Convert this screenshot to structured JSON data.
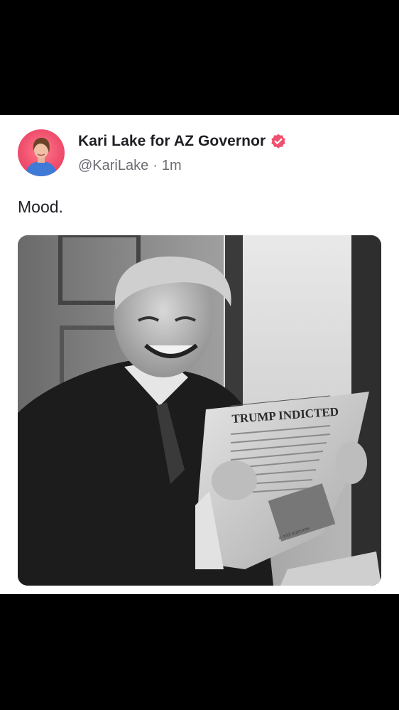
{
  "post": {
    "author": {
      "display_name": "Kari Lake for AZ Governor",
      "handle": "@KariLake",
      "verified": true,
      "avatar_icon": "profile-photo"
    },
    "timestamp": "1m",
    "separator": "·",
    "text": "Mood.",
    "media": {
      "kind": "black-and-white photo",
      "newspaper_headline": "TRUMP INDICTED",
      "small_caption": "a mid outcome"
    }
  },
  "colors": {
    "background": "#000000",
    "card": "#ffffff",
    "verified_badge": "#f0506e",
    "name": "#1e1e24",
    "meta": "#6b6b73"
  }
}
